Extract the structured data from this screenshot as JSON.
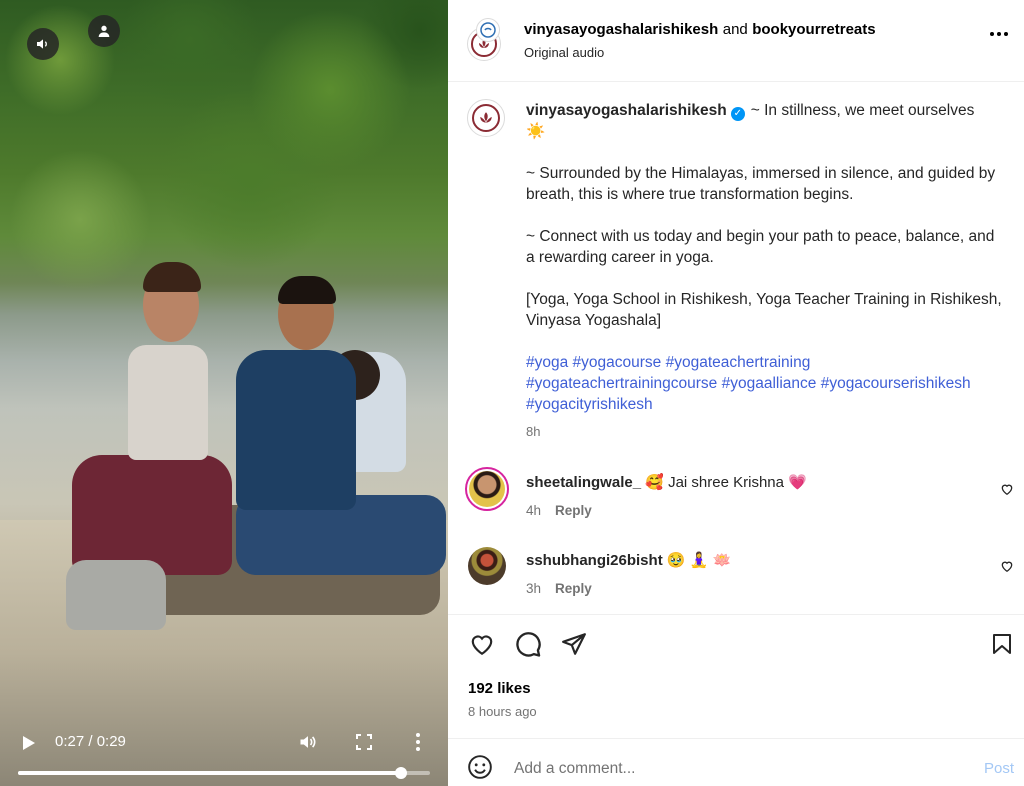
{
  "video": {
    "current_time": "0:27",
    "duration": "0:29",
    "time_display": "0:27 / 0:29",
    "progress_fraction": 0.93
  },
  "post_header": {
    "author": "vinyasayogashalarishikesh",
    "connector": "and",
    "collaborator": "bookyourretreats",
    "audio": "Original audio"
  },
  "caption": {
    "author": "vinyasayogashalarishikesh",
    "line1": "~ In stillness, we meet ourselves",
    "emoji1": "☀️",
    "para2": "~ Surrounded by the Himalayas, immersed in silence, and guided by breath, this is where true transformation begins.",
    "para3": "~ Connect with us today and begin your path to peace, balance, and a rewarding career in yoga.",
    "para4": "[Yoga, Yoga School in Rishikesh, Yoga Teacher Training in Rishikesh, Vinyasa Yogashala]",
    "hashtags": "#yoga #yogacourse #yogateachertraining #yogateachertrainingcourse #yogaalliance #yogacourserishikesh #yogacityrishikesh",
    "time": "8h"
  },
  "comments": [
    {
      "username": "sheetalingwale_",
      "text": "🥰 Jai shree Krishna 💗",
      "time": "4h",
      "reply": "Reply"
    },
    {
      "username": "sshubhangi26bisht",
      "text": "🥹 🧘‍♀️ 🪷",
      "time": "3h",
      "reply": "Reply"
    }
  ],
  "engagement": {
    "likes": "192 likes",
    "posted": "8 hours ago"
  },
  "comment_box": {
    "placeholder": "Add a comment...",
    "post_label": "Post"
  },
  "colors": {
    "link": "#3f5fd6",
    "verified": "#0095f6",
    "post_button_disabled": "#a4c8f5"
  },
  "icons": [
    "volume-icon",
    "user-tag-icon",
    "play-icon",
    "fullscreen-icon",
    "more-vertical-icon",
    "more-horizontal-icon",
    "heart-icon",
    "comment-icon",
    "share-icon",
    "bookmark-icon",
    "emoji-icon",
    "verified-badge-icon"
  ]
}
